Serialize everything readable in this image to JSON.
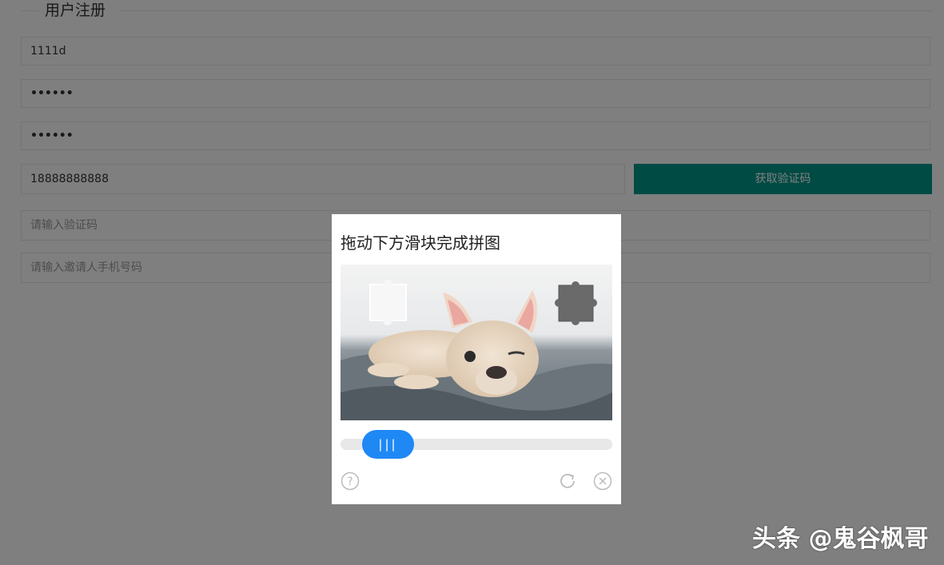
{
  "form": {
    "legend": "用户注册",
    "username_value": "1111d",
    "password_value": "••••••",
    "confirm_password_value": "••••••",
    "phone_value": "18888888888",
    "get_code_label": "获取验证码",
    "code_placeholder": "请输入验证码",
    "inviter_placeholder": "请输入邀请人手机号码"
  },
  "captcha": {
    "title": "拖动下方滑块完成拼图",
    "slider_handle_label": "|||",
    "icons": [
      "help-icon",
      "refresh-icon",
      "close-icon"
    ],
    "accent_color": "#1e88f5"
  },
  "watermark": "头条 @鬼谷枫哥",
  "colors": {
    "primary_button": "#009688",
    "overlay": "rgba(0,0,0,0.5)"
  }
}
